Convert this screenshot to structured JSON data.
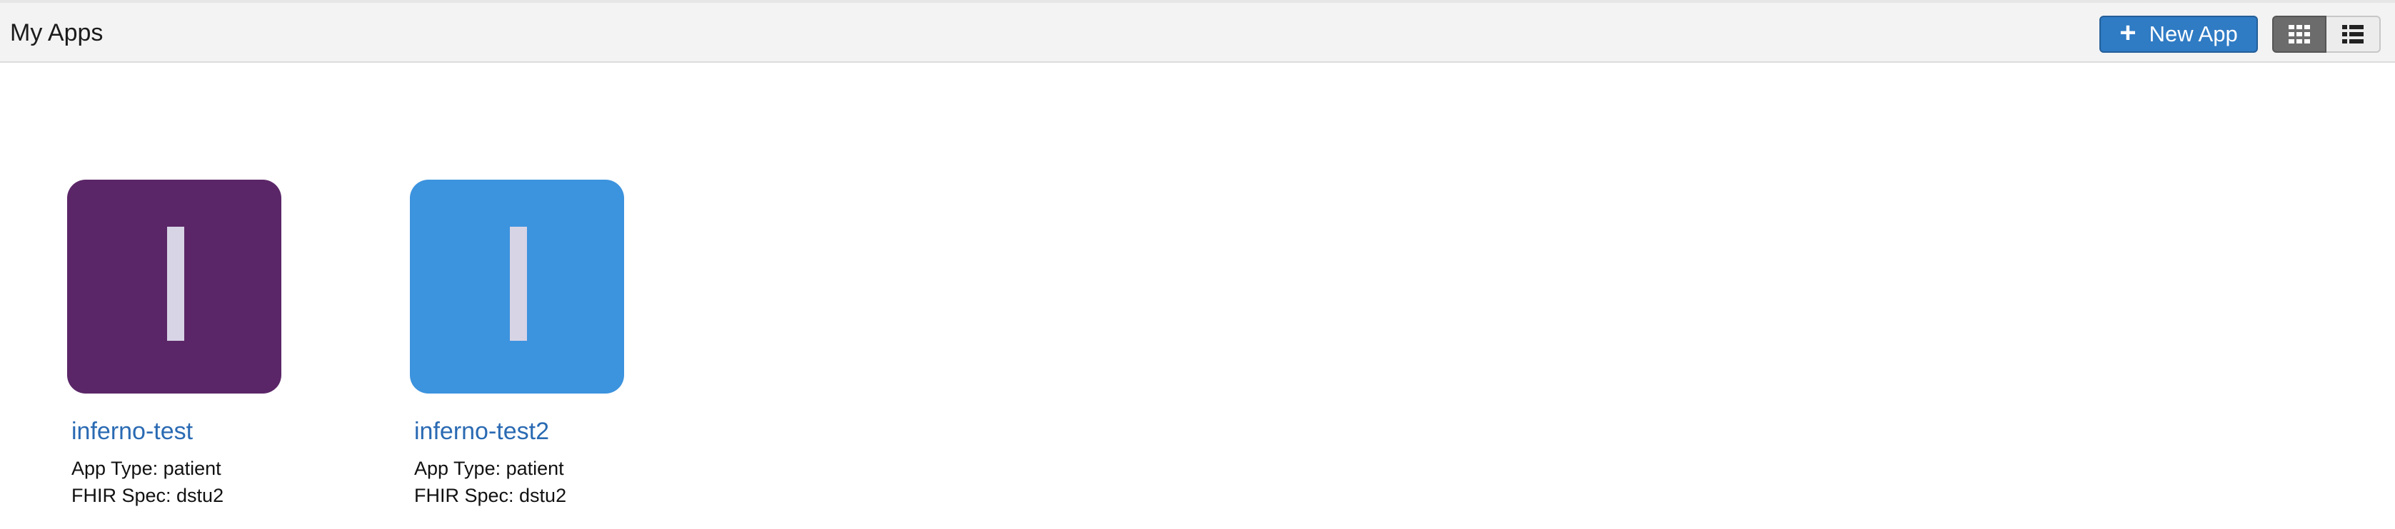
{
  "header": {
    "title": "My Apps",
    "new_app_label": "New App",
    "new_app_icon": "plus-icon",
    "view_toggle": {
      "grid_icon": "grid-view-icon",
      "list_icon": "list-view-icon",
      "active": "grid"
    }
  },
  "apps": [
    {
      "name": "inferno-test",
      "app_type": "App Type: patient",
      "fhir_spec": "FHIR Spec: dstu2",
      "tile_color": "#5b2668"
    },
    {
      "name": "inferno-test2",
      "app_type": "App Type: patient",
      "fhir_spec": "FHIR Spec: dstu2",
      "tile_color": "#3c93de"
    }
  ]
}
